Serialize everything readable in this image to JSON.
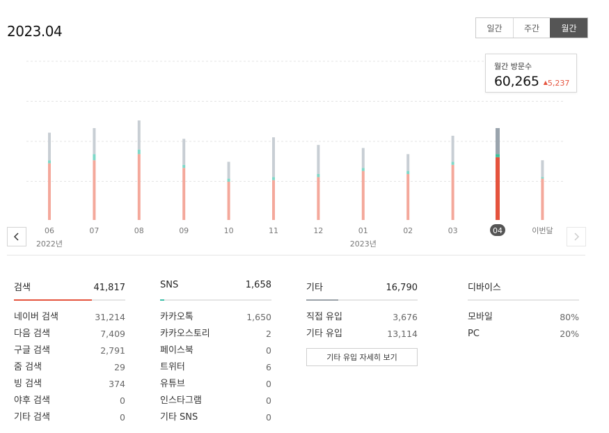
{
  "header": {
    "title": "2023.04"
  },
  "period_tabs": [
    {
      "label": "일간",
      "active": false
    },
    {
      "label": "주간",
      "active": false
    },
    {
      "label": "월간",
      "active": true
    }
  ],
  "tooltip": {
    "label": "월간 방문수",
    "value": "60,265",
    "change": "5,237",
    "change_dir": "up"
  },
  "chart_data": {
    "type": "bar",
    "categories": [
      "06",
      "07",
      "08",
      "09",
      "10",
      "11",
      "12",
      "01",
      "02",
      "03",
      "04",
      "이번달"
    ],
    "year_labels": [
      {
        "label": "2022년",
        "at": "06"
      },
      {
        "label": "2023년",
        "at": "01"
      }
    ],
    "selected": "04",
    "series": [
      {
        "color": "#f4a89b",
        "selected_color": "#e5533d",
        "values": [
          37,
          39,
          43,
          34,
          25,
          26,
          28,
          32,
          30,
          36,
          41,
          27
        ]
      },
      {
        "color": "#7fd8c8",
        "selected_color": "#3dbf9b",
        "values": [
          2,
          4,
          3,
          2,
          2,
          2,
          2,
          2,
          2,
          2,
          2,
          1
        ]
      },
      {
        "color": "#c8ced4",
        "selected_color": "#9aa4ad",
        "values": [
          18,
          17,
          19,
          17,
          11,
          26,
          19,
          13,
          11,
          17,
          17,
          11
        ]
      }
    ],
    "ylim": [
      0,
      80
    ],
    "grid": true
  },
  "stats": {
    "search": {
      "title": "검색",
      "total": "41,817",
      "fill": 0.7,
      "color": "#e5533d",
      "rows": [
        {
          "label": "네이버 검색",
          "value": "31,214"
        },
        {
          "label": "다음 검색",
          "value": "7,409"
        },
        {
          "label": "구글 검색",
          "value": "2,791"
        },
        {
          "label": "줌 검색",
          "value": "29"
        },
        {
          "label": "빙 검색",
          "value": "374"
        },
        {
          "label": "야후 검색",
          "value": "0"
        },
        {
          "label": "기타 검색",
          "value": "0"
        }
      ]
    },
    "sns": {
      "title": "SNS",
      "total": "1,658",
      "fill": 0.04,
      "color": "#3dbfa8",
      "rows": [
        {
          "label": "카카오톡",
          "value": "1,650"
        },
        {
          "label": "카카오스토리",
          "value": "2"
        },
        {
          "label": "페이스북",
          "value": "0"
        },
        {
          "label": "트위터",
          "value": "6"
        },
        {
          "label": "유튜브",
          "value": "0"
        },
        {
          "label": "인스타그램",
          "value": "0"
        },
        {
          "label": "기타 SNS",
          "value": "0"
        }
      ]
    },
    "etc": {
      "title": "기타",
      "total": "16,790",
      "fill": 0.29,
      "color": "#9aa1a8",
      "rows": [
        {
          "label": "직접 유입",
          "value": "3,676"
        },
        {
          "label": "기타 유입",
          "value": "13,114"
        }
      ],
      "detail_button": "기타 유입 자세히 보기"
    },
    "device": {
      "title": "디바이스",
      "total": "",
      "rows": [
        {
          "label": "모바일",
          "value": "80%"
        },
        {
          "label": "PC",
          "value": "20%"
        }
      ]
    }
  }
}
